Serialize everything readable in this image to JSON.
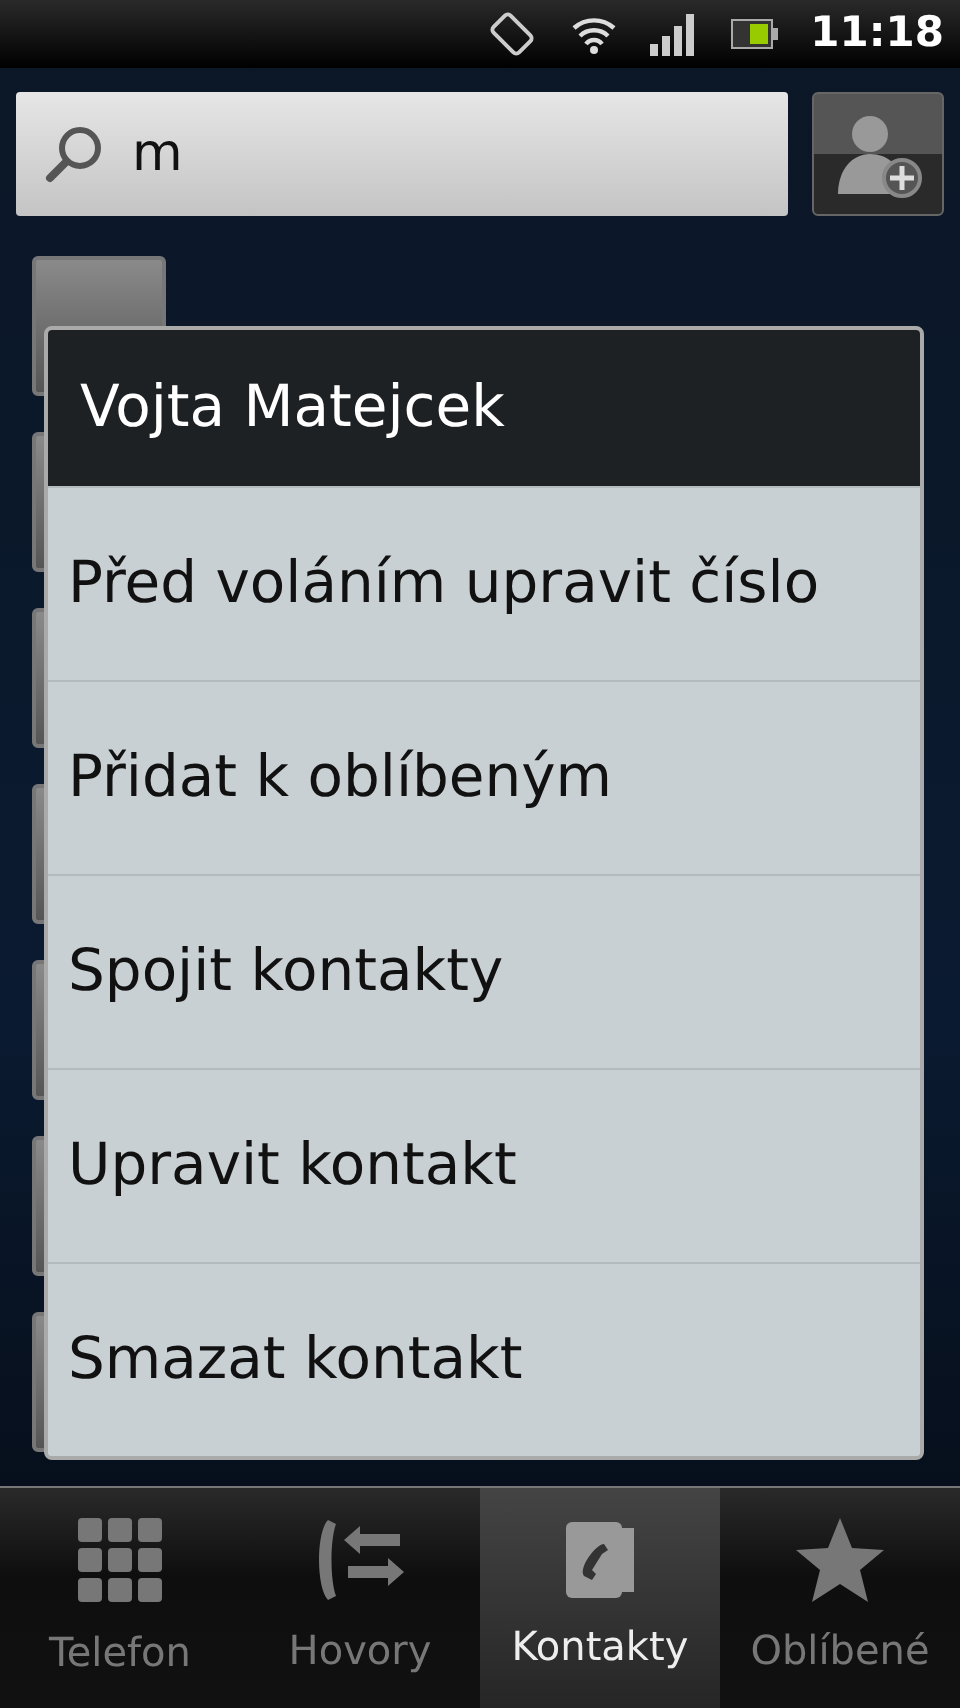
{
  "status_bar": {
    "time": "11:18"
  },
  "search": {
    "value": "m"
  },
  "contacts_behind": [
    {
      "kind": "avatar"
    },
    {
      "kind": "avatar"
    },
    {
      "kind": "avatar"
    },
    {
      "kind": "avatar"
    },
    {
      "kind": "avatar"
    },
    {
      "kind": "avatar"
    },
    {
      "kind": "avatar"
    }
  ],
  "context_menu": {
    "title": "Vojta Matejcek",
    "items": [
      "Před voláním upravit číslo",
      "Přidat k oblíbeným",
      "Spojit kontakty",
      "Upravit kontakt",
      "Smazat kontakt"
    ]
  },
  "tabs": [
    {
      "label": "Telefon",
      "kind": "dialpad",
      "selected": false
    },
    {
      "label": "Hovory",
      "kind": "calls",
      "selected": false
    },
    {
      "label": "Kontakty",
      "kind": "contacts",
      "selected": true
    },
    {
      "label": "Oblíbené",
      "kind": "star",
      "selected": false
    }
  ]
}
